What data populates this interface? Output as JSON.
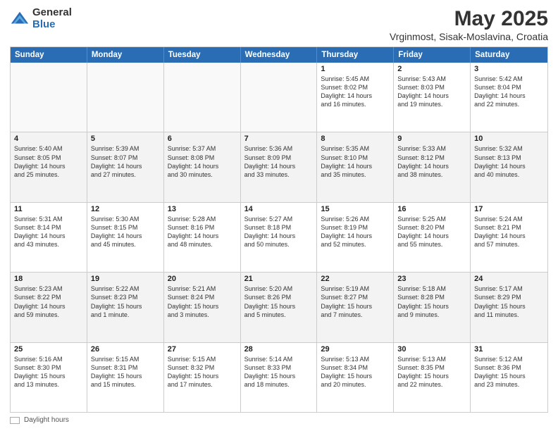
{
  "logo": {
    "general": "General",
    "blue": "Blue"
  },
  "title": "May 2025",
  "subtitle": "Vrginmost, Sisak-Moslavina, Croatia",
  "days_of_week": [
    "Sunday",
    "Monday",
    "Tuesday",
    "Wednesday",
    "Thursday",
    "Friday",
    "Saturday"
  ],
  "footer_label": "Daylight hours",
  "weeks": [
    [
      {
        "day": "",
        "empty": true
      },
      {
        "day": "",
        "empty": true
      },
      {
        "day": "",
        "empty": true
      },
      {
        "day": "",
        "empty": true
      },
      {
        "day": "1",
        "text": "Sunrise: 5:45 AM\nSunset: 8:02 PM\nDaylight: 14 hours\nand 16 minutes."
      },
      {
        "day": "2",
        "text": "Sunrise: 5:43 AM\nSunset: 8:03 PM\nDaylight: 14 hours\nand 19 minutes."
      },
      {
        "day": "3",
        "text": "Sunrise: 5:42 AM\nSunset: 8:04 PM\nDaylight: 14 hours\nand 22 minutes."
      }
    ],
    [
      {
        "day": "4",
        "text": "Sunrise: 5:40 AM\nSunset: 8:05 PM\nDaylight: 14 hours\nand 25 minutes."
      },
      {
        "day": "5",
        "text": "Sunrise: 5:39 AM\nSunset: 8:07 PM\nDaylight: 14 hours\nand 27 minutes."
      },
      {
        "day": "6",
        "text": "Sunrise: 5:37 AM\nSunset: 8:08 PM\nDaylight: 14 hours\nand 30 minutes."
      },
      {
        "day": "7",
        "text": "Sunrise: 5:36 AM\nSunset: 8:09 PM\nDaylight: 14 hours\nand 33 minutes."
      },
      {
        "day": "8",
        "text": "Sunrise: 5:35 AM\nSunset: 8:10 PM\nDaylight: 14 hours\nand 35 minutes."
      },
      {
        "day": "9",
        "text": "Sunrise: 5:33 AM\nSunset: 8:12 PM\nDaylight: 14 hours\nand 38 minutes."
      },
      {
        "day": "10",
        "text": "Sunrise: 5:32 AM\nSunset: 8:13 PM\nDaylight: 14 hours\nand 40 minutes."
      }
    ],
    [
      {
        "day": "11",
        "text": "Sunrise: 5:31 AM\nSunset: 8:14 PM\nDaylight: 14 hours\nand 43 minutes."
      },
      {
        "day": "12",
        "text": "Sunrise: 5:30 AM\nSunset: 8:15 PM\nDaylight: 14 hours\nand 45 minutes."
      },
      {
        "day": "13",
        "text": "Sunrise: 5:28 AM\nSunset: 8:16 PM\nDaylight: 14 hours\nand 48 minutes."
      },
      {
        "day": "14",
        "text": "Sunrise: 5:27 AM\nSunset: 8:18 PM\nDaylight: 14 hours\nand 50 minutes."
      },
      {
        "day": "15",
        "text": "Sunrise: 5:26 AM\nSunset: 8:19 PM\nDaylight: 14 hours\nand 52 minutes."
      },
      {
        "day": "16",
        "text": "Sunrise: 5:25 AM\nSunset: 8:20 PM\nDaylight: 14 hours\nand 55 minutes."
      },
      {
        "day": "17",
        "text": "Sunrise: 5:24 AM\nSunset: 8:21 PM\nDaylight: 14 hours\nand 57 minutes."
      }
    ],
    [
      {
        "day": "18",
        "text": "Sunrise: 5:23 AM\nSunset: 8:22 PM\nDaylight: 14 hours\nand 59 minutes."
      },
      {
        "day": "19",
        "text": "Sunrise: 5:22 AM\nSunset: 8:23 PM\nDaylight: 15 hours\nand 1 minute."
      },
      {
        "day": "20",
        "text": "Sunrise: 5:21 AM\nSunset: 8:24 PM\nDaylight: 15 hours\nand 3 minutes."
      },
      {
        "day": "21",
        "text": "Sunrise: 5:20 AM\nSunset: 8:26 PM\nDaylight: 15 hours\nand 5 minutes."
      },
      {
        "day": "22",
        "text": "Sunrise: 5:19 AM\nSunset: 8:27 PM\nDaylight: 15 hours\nand 7 minutes."
      },
      {
        "day": "23",
        "text": "Sunrise: 5:18 AM\nSunset: 8:28 PM\nDaylight: 15 hours\nand 9 minutes."
      },
      {
        "day": "24",
        "text": "Sunrise: 5:17 AM\nSunset: 8:29 PM\nDaylight: 15 hours\nand 11 minutes."
      }
    ],
    [
      {
        "day": "25",
        "text": "Sunrise: 5:16 AM\nSunset: 8:30 PM\nDaylight: 15 hours\nand 13 minutes."
      },
      {
        "day": "26",
        "text": "Sunrise: 5:15 AM\nSunset: 8:31 PM\nDaylight: 15 hours\nand 15 minutes."
      },
      {
        "day": "27",
        "text": "Sunrise: 5:15 AM\nSunset: 8:32 PM\nDaylight: 15 hours\nand 17 minutes."
      },
      {
        "day": "28",
        "text": "Sunrise: 5:14 AM\nSunset: 8:33 PM\nDaylight: 15 hours\nand 18 minutes."
      },
      {
        "day": "29",
        "text": "Sunrise: 5:13 AM\nSunset: 8:34 PM\nDaylight: 15 hours\nand 20 minutes."
      },
      {
        "day": "30",
        "text": "Sunrise: 5:13 AM\nSunset: 8:35 PM\nDaylight: 15 hours\nand 22 minutes."
      },
      {
        "day": "31",
        "text": "Sunrise: 5:12 AM\nSunset: 8:36 PM\nDaylight: 15 hours\nand 23 minutes."
      }
    ]
  ]
}
